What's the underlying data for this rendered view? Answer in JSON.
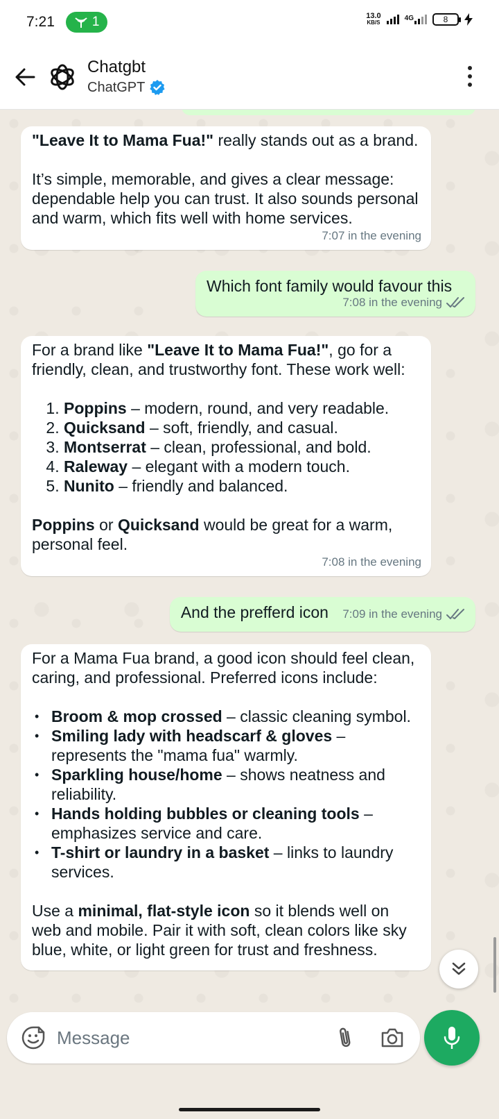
{
  "status_bar": {
    "time": "7:21",
    "hotspot_count": "1",
    "net_speed_value": "13.0",
    "net_speed_unit": "KB/S",
    "network_type": "4G",
    "battery_level": "8"
  },
  "header": {
    "title": "Chatgbt",
    "subtitle": "ChatGPT"
  },
  "messages": {
    "m1": {
      "brand": "\"Leave It to Mama Fua!\"",
      "line1_rest": " really stands out as a brand.",
      "para2": "It’s simple, memorable, and gives a clear message: dependable help you can trust. It also sounds personal and warm, which fits well with home services.",
      "time": "7:07 in the evening"
    },
    "m2": {
      "text": "Which font family would favour this",
      "time": "7:08 in the evening"
    },
    "m3": {
      "intro_a": "For a brand like ",
      "intro_brand": "\"Leave It to Mama Fua!\"",
      "intro_b": ", go for a friendly, clean, and trustworthy font. These work well:",
      "fonts": [
        {
          "name": "Poppins",
          "desc": " – modern, round, and very readable."
        },
        {
          "name": "Quicksand",
          "desc": " – soft, friendly, and casual."
        },
        {
          "name": "Montserrat",
          "desc": " – clean, professional, and bold."
        },
        {
          "name": "Raleway",
          "desc": " – elegant with a modern touch."
        },
        {
          "name": "Nunito",
          "desc": " – friendly and balanced."
        }
      ],
      "outro_a": "Poppins",
      "outro_b": " or ",
      "outro_c": "Quicksand",
      "outro_d": " would be great for a warm, personal feel.",
      "time": "7:08 in the evening"
    },
    "m4": {
      "text": "And the prefferd icon",
      "time": "7:09 in the evening"
    },
    "m5": {
      "intro": "For a Mama Fua brand, a good icon should feel clean, caring, and professional. Preferred icons include:",
      "icons": [
        {
          "name": "Broom & mop crossed",
          "desc": " – classic cleaning symbol."
        },
        {
          "name": "Smiling lady with headscarf & gloves",
          "desc": " – represents the \"mama fua\" warmly."
        },
        {
          "name": "Sparkling house/home",
          "desc": " – shows neatness and reliability."
        },
        {
          "name": "Hands holding bubbles or cleaning tools",
          "desc": " – emphasizes service and care."
        },
        {
          "name": "T-shirt or laundry in a basket",
          "desc": " – links to laundry services."
        }
      ],
      "outro_a": "Use a ",
      "outro_b": "minimal, flat-style icon",
      "outro_c": " so it blends well on web and mobile. Pair it with soft, clean colors like sky blue, white, or light green for trust and freshness."
    }
  },
  "composer": {
    "placeholder": "Message"
  },
  "colors": {
    "incoming_bubble": "#ffffff",
    "outgoing_bubble": "#d9fdd3",
    "accent_green": "#1daa61",
    "verified_blue": "#1d9bf0",
    "read_ticks": "#667781"
  },
  "icons": [
    "back-arrow-icon",
    "chatgpt-logo-icon",
    "verified-badge-icon",
    "more-options-icon",
    "double-check-icon",
    "chevron-double-down-icon",
    "emoji-icon",
    "attach-icon",
    "camera-icon",
    "mic-icon",
    "hotspot-icon"
  ]
}
